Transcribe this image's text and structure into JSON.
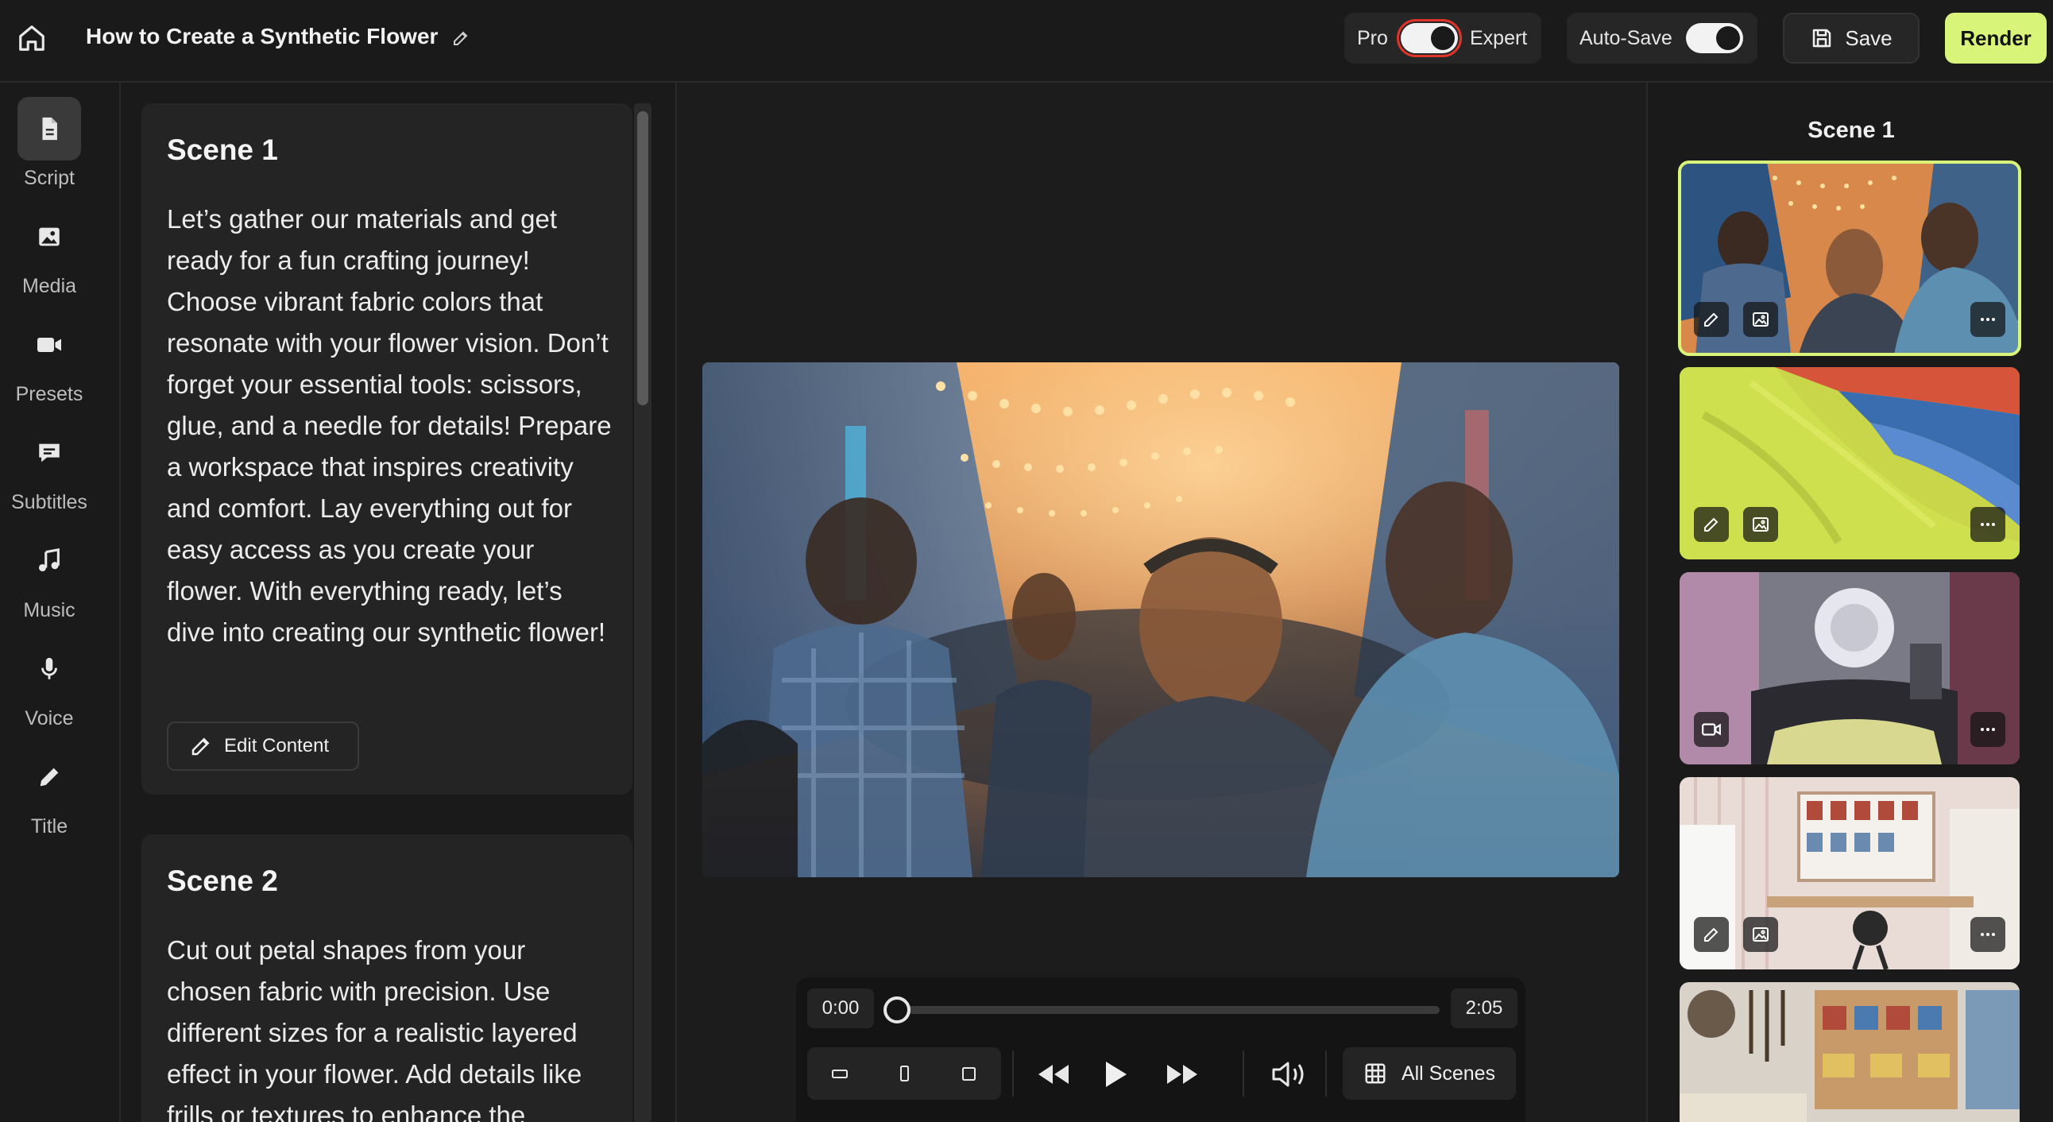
{
  "header": {
    "title": "How to Create a Synthetic Flower",
    "mode_left": "Pro",
    "mode_right": "Expert",
    "autosave_label": "Auto-Save",
    "save_label": "Save",
    "render_label": "Render"
  },
  "nav": {
    "items": [
      {
        "label": "Script",
        "icon": "script-icon"
      },
      {
        "label": "Media",
        "icon": "image-icon"
      },
      {
        "label": "Presets",
        "icon": "video-icon"
      },
      {
        "label": "Subtitles",
        "icon": "subtitle-icon"
      },
      {
        "label": "Music",
        "icon": "music-icon"
      },
      {
        "label": "Voice",
        "icon": "microphone-icon"
      },
      {
        "label": "Title",
        "icon": "pencil-icon"
      }
    ]
  },
  "script": {
    "scenes": [
      {
        "title": "Scene 1",
        "text": "Let’s gather our materials and get ready for a fun crafting journey! Choose vibrant fabric colors that resonate with your flower vision. Don’t forget your essential tools: scissors, glue, and a needle for details! Prepare a workspace that inspires creativity and comfort. Lay everything out for easy access as you create your flower. With everything ready, let’s dive into creating our synthetic flower!",
        "edit_label": "Edit Content"
      },
      {
        "title": "Scene 2",
        "text": "Cut out petal shapes from your chosen fabric with precision. Use different sizes for a realistic layered effect in your flower. Add details like frills or textures to enhance the"
      }
    ]
  },
  "player": {
    "time_start": "0:00",
    "time_end": "2:05",
    "progress": 0,
    "all_scenes_label": "All Scenes"
  },
  "scenes_panel": {
    "heading": "Scene 1"
  }
}
